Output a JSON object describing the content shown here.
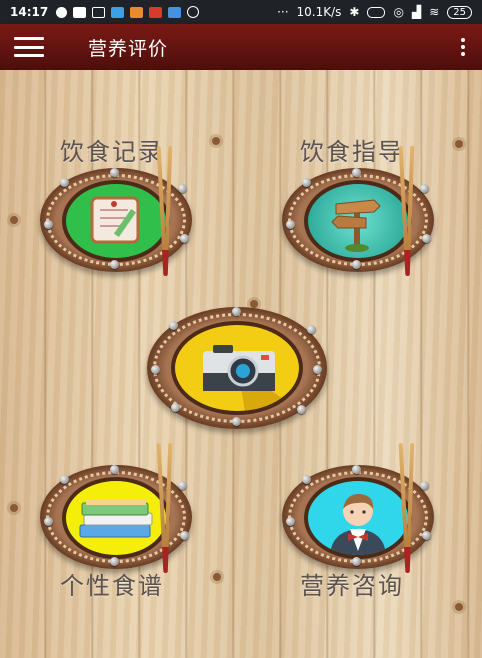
{
  "status_bar": {
    "time": "14:17",
    "network_speed": "10.1K/s",
    "dots": "···",
    "battery": "25"
  },
  "app_bar": {
    "title": "营养评价",
    "menu_icon": "hamburger-menu-icon",
    "overflow_icon": "more-vert-icon",
    "color": "#6a1410"
  },
  "menu_items": [
    {
      "label": "饮食记录",
      "icon": "notebook-icon",
      "plate_color": "#2fbf4a"
    },
    {
      "label": "饮食指导",
      "icon": "signpost-icon",
      "plate_color": "#2bb8a8"
    },
    {
      "label": "",
      "icon": "camera-icon",
      "plate_color": "#f3cc14"
    },
    {
      "label": "个性食谱",
      "icon": "books-icon",
      "plate_color": "#f5ee0a"
    },
    {
      "label": "营养咨询",
      "icon": "waiter-icon",
      "plate_color": "#30d6ea"
    }
  ]
}
